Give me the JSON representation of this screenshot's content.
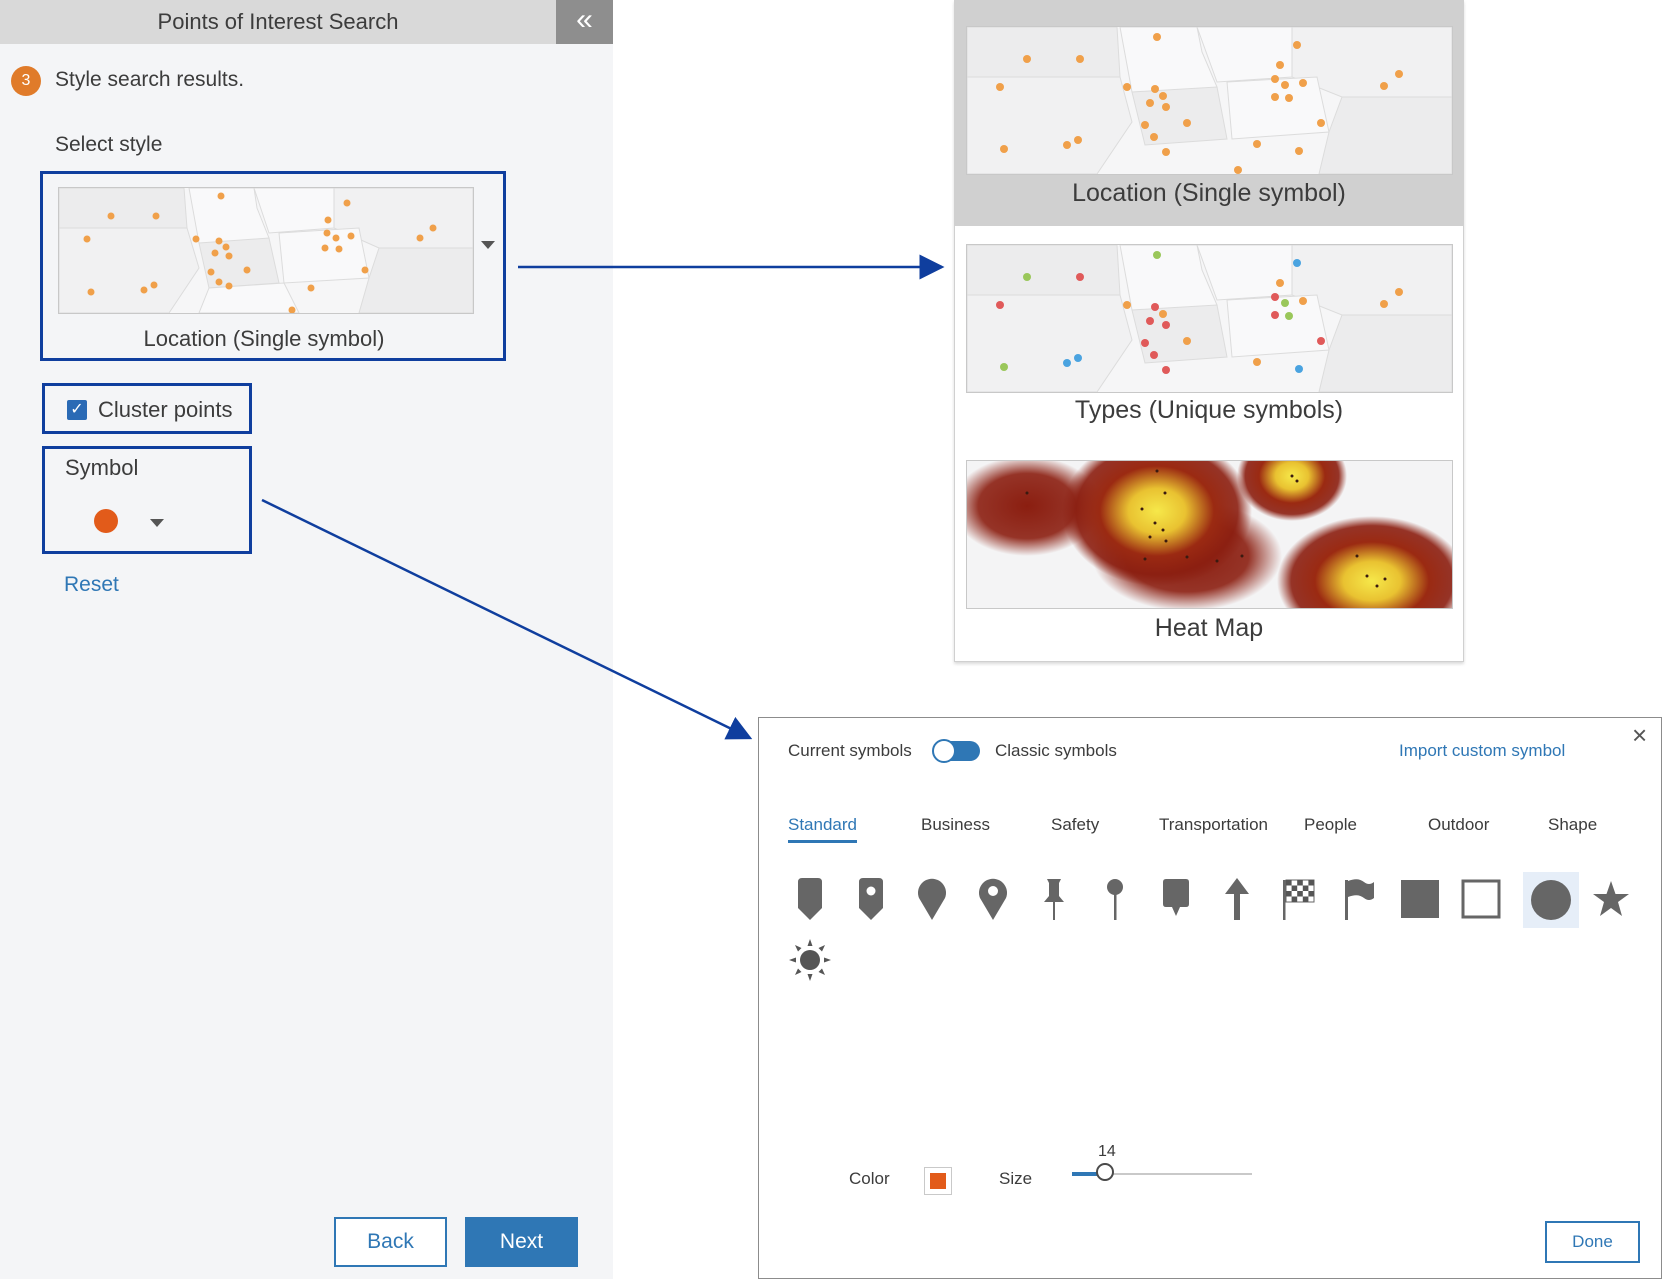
{
  "panel": {
    "title": "Points of Interest Search",
    "collapse_icon": "«",
    "step_number": "3",
    "step_title": "Style search results.",
    "select_style_label": "Select style",
    "selected_style": "Location (Single symbol)",
    "cluster_label": "Cluster points",
    "cluster_checked": true,
    "symbol_label": "Symbol",
    "symbol_color": "#e25b1a",
    "reset_label": "Reset",
    "back_label": "Back",
    "next_label": "Next"
  },
  "style_options": [
    {
      "label": "Location (Single symbol)",
      "selected": true
    },
    {
      "label": "Types (Unique symbols)",
      "selected": false
    },
    {
      "label": "Heat Map",
      "selected": false
    }
  ],
  "symbol_dialog": {
    "current_label": "Current symbols",
    "classic_label": "Classic symbols",
    "import_label": "Import custom symbol",
    "close_icon": "×",
    "tabs": [
      "Standard",
      "Business",
      "Safety",
      "Transportation",
      "People",
      "Outdoor",
      "Shape"
    ],
    "active_tab": "Standard",
    "symbols": [
      "marker-icon",
      "marker-hole-icon",
      "pin-icon",
      "pin-hole-icon",
      "pushpin-icon",
      "round-pin-icon",
      "callout-icon",
      "arrow-up-icon",
      "checkered-flag-icon",
      "flag-icon",
      "square-filled-icon",
      "square-outline-icon",
      "circle-filled-icon",
      "star-icon",
      "sun-icon"
    ],
    "selected_symbol": "circle-filled-icon",
    "color_label": "Color",
    "color_value": "#e25b1a",
    "size_label": "Size",
    "size_value": "14",
    "done_label": "Done"
  },
  "colors": {
    "accent": "#2f77b5",
    "annotation": "#0f3e9e",
    "step_badge": "#e07b2a",
    "point_orange": "#f0a04a"
  }
}
